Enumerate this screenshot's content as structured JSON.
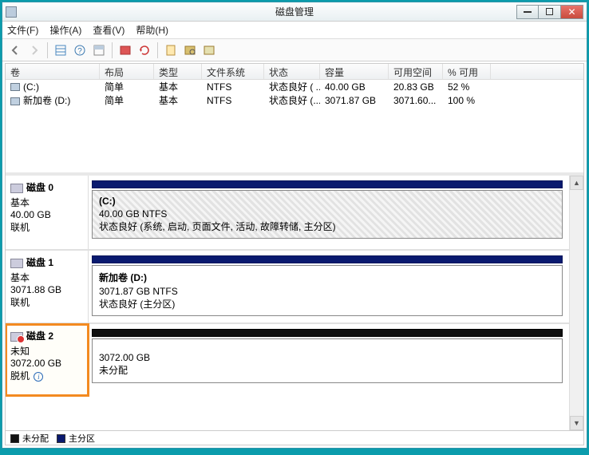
{
  "titlebar": {
    "title": "磁盘管理"
  },
  "menu": {
    "file": "文件(F)",
    "action": "操作(A)",
    "view": "查看(V)",
    "help": "帮助(H)"
  },
  "columns": {
    "volume": "卷",
    "layout": "布局",
    "type": "类型",
    "fs": "文件系统",
    "status": "状态",
    "capacity": "容量",
    "free": "可用空间",
    "pct": "% 可用"
  },
  "volumes": [
    {
      "name": "(C:)",
      "layout": "简单",
      "type": "基本",
      "fs": "NTFS",
      "status": "状态良好 ( ...",
      "capacity": "40.00 GB",
      "free": "20.83 GB",
      "pct": "52 %"
    },
    {
      "name": "新加卷 (D:)",
      "layout": "简单",
      "type": "基本",
      "fs": "NTFS",
      "status": "状态良好 (...",
      "capacity": "3071.87 GB",
      "free": "3071.60...",
      "pct": "100 %"
    }
  ],
  "disks": [
    {
      "name": "磁盘 0",
      "type": "基本",
      "size": "40.00 GB",
      "state": "联机",
      "part": {
        "title": "(C:)",
        "line2": "40.00 GB NTFS",
        "line3": "状态良好 (系统, 启动, 页面文件, 活动, 故障转储, 主分区)"
      },
      "bar": "blue",
      "hatched": true
    },
    {
      "name": "磁盘 1",
      "type": "基本",
      "size": "3071.88 GB",
      "state": "联机",
      "part": {
        "title": "新加卷  (D:)",
        "line2": "3071.87 GB NTFS",
        "line3": "状态良好 (主分区)"
      },
      "bar": "blue",
      "hatched": false
    },
    {
      "name": "磁盘 2",
      "type": "未知",
      "size": "3072.00 GB",
      "state": "脱机",
      "part": {
        "title": "",
        "line2": "3072.00 GB",
        "line3": "未分配"
      },
      "bar": "black",
      "hatched": false,
      "highlight": true,
      "info": true
    }
  ],
  "legend": {
    "unalloc": "未分配",
    "primary": "主分区"
  }
}
